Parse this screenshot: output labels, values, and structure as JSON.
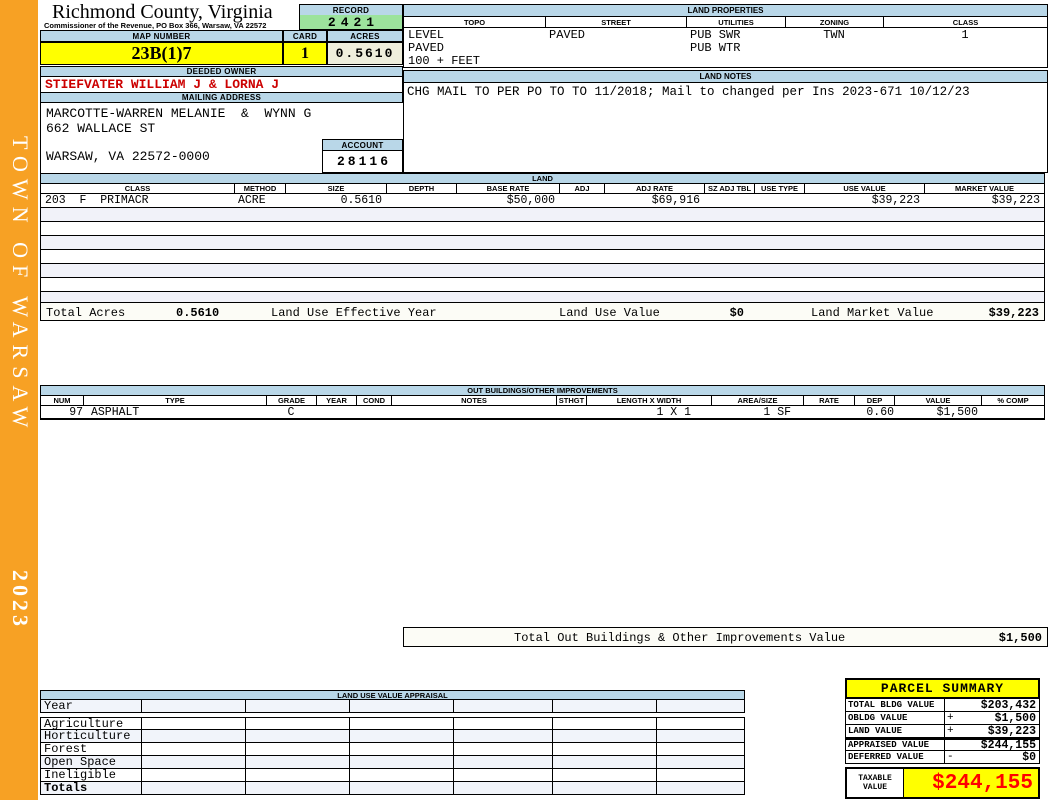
{
  "sidebar": {
    "org": "TOWN OF WARSAW",
    "year": "2023"
  },
  "header": {
    "county": "Richmond County, Virginia",
    "sub": "Commissioner of the Revenue, PO Box 366, Warsaw, VA 22572"
  },
  "record": {
    "label": "RECORD",
    "value": "2421"
  },
  "map": {
    "label": "MAP NUMBER",
    "value": "23B(1)7"
  },
  "card": {
    "label": "CARD",
    "value": "1"
  },
  "acres": {
    "label": "ACRES",
    "value": "0.5610"
  },
  "owner": {
    "label": "DEEDED OWNER",
    "name": "STIEFVATER WILLIAM J & LORNA J"
  },
  "mailing": {
    "label": "MAILING ADDRESS",
    "line1": "MARCOTTE-WARREN MELANIE  &  WYNN G",
    "line2": "662 WALLACE ST",
    "line3": "WARSAW, VA 22572-0000"
  },
  "account": {
    "label": "ACCOUNT",
    "value": "28116"
  },
  "land_properties": {
    "title": "LAND PROPERTIES",
    "columns": [
      "TOPO",
      "STREET",
      "UTILITIES",
      "ZONING",
      "CLASS"
    ],
    "rows": [
      [
        "LEVEL",
        "PAVED",
        "PUB SWR",
        "TWN",
        "1"
      ],
      [
        "PAVED",
        "",
        "PUB WTR",
        "",
        ""
      ],
      [
        "100 + FEET",
        "",
        "",
        "",
        ""
      ]
    ]
  },
  "land_notes": {
    "title": "LAND NOTES",
    "text": "CHG MAIL TO PER PO TO TO 11/2018; Mail to changed per Ins 2023-671 10/12/23"
  },
  "land": {
    "title": "LAND",
    "columns": [
      "CLASS",
      "METHOD",
      "SIZE",
      "DEPTH",
      "BASE RATE",
      "ADJ",
      "ADJ RATE",
      "SZ ADJ TBL",
      "USE TYPE",
      "USE VALUE",
      "MARKET VALUE"
    ],
    "row": {
      "class": "203  F  PRIMACR",
      "method": "ACRE",
      "size": "0.5610",
      "depth": "",
      "base_rate": "$50,000",
      "adj": "",
      "adj_rate": "$69,916",
      "sz_adj_tbl": "",
      "use_type": "",
      "use_value": "$39,223",
      "market_value": "$39,223"
    },
    "totals": {
      "total_acres_label": "Total Acres",
      "total_acres": "0.5610",
      "effective_year_label": "Land Use Effective Year",
      "use_value_label": "Land Use Value",
      "use_value": "$0",
      "market_value_label": "Land Market Value",
      "market_value": "$39,223"
    }
  },
  "out_buildings": {
    "title": "OUT BUILDINGS/OTHER IMPROVEMENTS",
    "columns": [
      "NUM",
      "TYPE",
      "GRADE",
      "YEAR",
      "COND",
      "NOTES",
      "STHGT",
      "LENGTH X WIDTH",
      "AREA/SIZE",
      "RATE",
      "DEP",
      "VALUE",
      "% COMP"
    ],
    "row": {
      "num": "97",
      "type": "ASPHALT",
      "grade": "C",
      "year": "",
      "cond": "",
      "notes": "",
      "sthgt": "",
      "length_x_width": "1 X 1",
      "area_size": "1 SF",
      "rate": "",
      "dep": "0.60",
      "value": "$1,500",
      "pct_comp": ""
    },
    "total_label": "Total Out Buildings & Other Improvements Value",
    "total_value": "$1,500"
  },
  "land_use_appraisal": {
    "title": "LAND USE VALUE APPRAISAL",
    "row_labels": [
      "Year",
      "Agriculture",
      "Horticulture",
      "Forest",
      "Open Space",
      "Ineligible",
      "Totals"
    ]
  },
  "parcel_summary": {
    "title": "PARCEL SUMMARY",
    "rows": [
      {
        "label": "TOTAL BLDG VALUE",
        "op": "",
        "value": "$203,432"
      },
      {
        "label": "OBLDG VALUE",
        "op": "+",
        "value": "$1,500"
      },
      {
        "label": "LAND VALUE",
        "op": "+",
        "value": "$39,223"
      },
      {
        "label": "APPRAISED VALUE",
        "op": "",
        "value": "$244,155"
      },
      {
        "label": "DEFERRED VALUE",
        "op": "-",
        "value": "$0"
      }
    ],
    "taxable": {
      "label": "TAXABLE VALUE",
      "value": "$244,155"
    }
  },
  "colors": {
    "header_blue": "#B9D7E8",
    "record_green": "#9CE39C",
    "highlight_yellow": "#FFFF00",
    "acres_cream": "#EFEEDC",
    "sidebar_orange": "#F7A124",
    "owner_red": "#CC0000",
    "taxable_red": "#FF0000"
  }
}
